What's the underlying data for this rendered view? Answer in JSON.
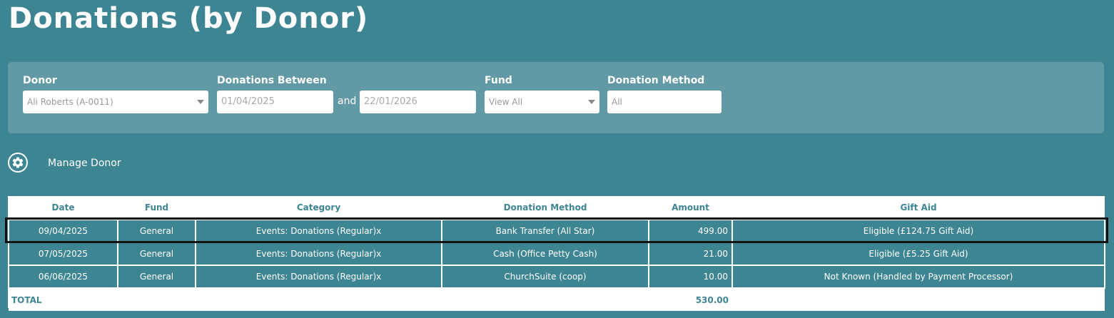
{
  "page": {
    "title": "Donations (by Donor)"
  },
  "filters": {
    "donor": {
      "label": "Donor",
      "value": "Ali Roberts (A-0011)"
    },
    "between": {
      "label": "Donations Between",
      "from": "01/04/2025",
      "joiner": "and",
      "to": "22/01/2026"
    },
    "fund": {
      "label": "Fund",
      "value": "View All"
    },
    "method": {
      "label": "Donation Method",
      "value": "All"
    }
  },
  "actions": {
    "manage_donor": "Manage Donor",
    "icon": "gear-icon"
  },
  "table": {
    "headers": [
      "Date",
      "Fund",
      "Category",
      "Donation Method",
      "Amount",
      "Gift Aid"
    ],
    "rows": [
      [
        "09/04/2025",
        "General",
        "Events: Donations (Regular)x",
        "Bank Transfer (All Star)",
        "499.00",
        "Eligible (£124.75 Gift Aid)"
      ],
      [
        "07/05/2025",
        "General",
        "Events: Donations (Regular)x",
        "Cash (Office Petty Cash)",
        "21.00",
        "Eligible (£5.25 Gift Aid)"
      ],
      [
        "06/06/2025",
        "General",
        "Events: Donations (Regular)x",
        "ChurchSuite (coop)",
        "10.00",
        "Not Known (Handled by Payment Processor)"
      ]
    ],
    "total": {
      "label": "TOTAL",
      "amount": "530.00"
    }
  },
  "colors": {
    "background": "#3e8593",
    "panel": "#6199a4",
    "header_text": "#3e8593"
  }
}
